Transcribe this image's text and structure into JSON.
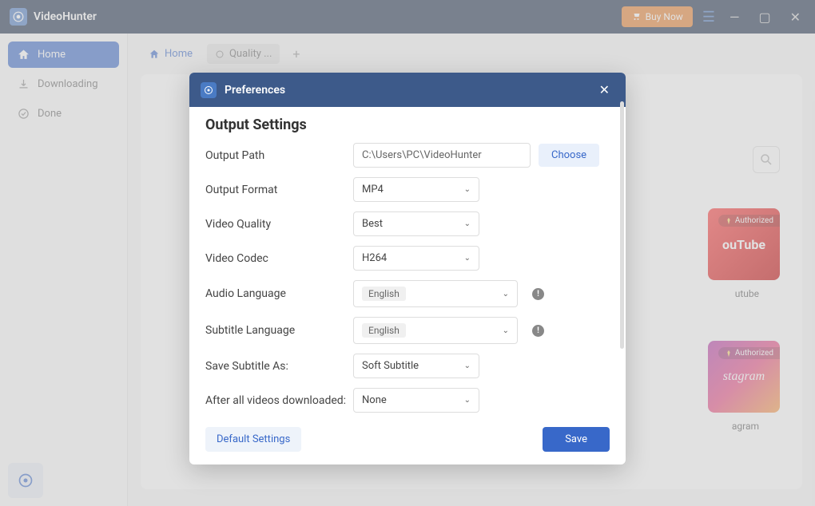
{
  "titlebar": {
    "app_name": "VideoHunter",
    "buy_label": "Buy Now"
  },
  "sidebar": {
    "items": [
      {
        "label": "Home"
      },
      {
        "label": "Downloading"
      },
      {
        "label": "Done"
      }
    ]
  },
  "tabs": {
    "home": "Home",
    "quality": "Quality ..."
  },
  "sites": {
    "youtube": {
      "brand": "ouTube",
      "label": "utube",
      "badge": "Authorized"
    },
    "instagram": {
      "brand": "stagram",
      "label": "agram",
      "badge": "Authorized"
    }
  },
  "modal": {
    "title": "Preferences",
    "section": "Output Settings",
    "labels": {
      "output_path": "Output Path",
      "output_format": "Output Format",
      "video_quality": "Video Quality",
      "video_codec": "Video Codec",
      "audio_language": "Audio Language",
      "subtitle_language": "Subtitle Language",
      "save_subtitle_as": "Save Subtitle As:",
      "after_downloaded": "After all videos downloaded:"
    },
    "values": {
      "output_path": "C:\\Users\\PC\\VideoHunter",
      "output_format": "MP4",
      "video_quality": "Best",
      "video_codec": "H264",
      "audio_language": "English",
      "subtitle_language": "English",
      "save_subtitle_as": "Soft Subtitle",
      "after_downloaded": "None"
    },
    "buttons": {
      "choose": "Choose",
      "default": "Default Settings",
      "save": "Save"
    }
  }
}
